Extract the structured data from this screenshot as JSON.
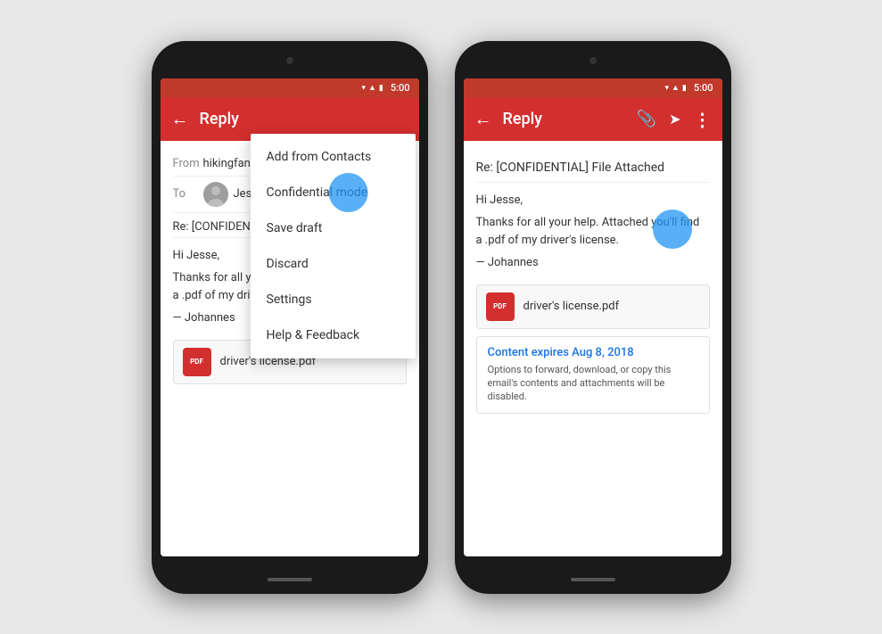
{
  "phone1": {
    "statusBar": {
      "time": "5:00"
    },
    "toolbar": {
      "title": "Reply",
      "backIcon": "←"
    },
    "emailFields": {
      "fromLabel": "From",
      "fromValue": "hikingfan@gma...",
      "toLabel": "To",
      "toValue": "Jesse Slit..."
    },
    "subject": "Re: [CONFIDENTIAL] Fil...",
    "bodyLines": [
      "Hi Jesse,",
      "",
      "Thanks for all your help. Attached you'll find",
      "a .pdf of my driver's license.",
      "",
      "— Johannes"
    ],
    "attachment": {
      "iconText": "PDF",
      "name": "driver's license.pdf"
    },
    "dropdown": {
      "items": [
        "Add from Contacts",
        "Confidential mode",
        "Save draft",
        "Discard",
        "Settings",
        "Help & Feedback"
      ]
    }
  },
  "phone2": {
    "statusBar": {
      "time": "5:00"
    },
    "toolbar": {
      "title": "Reply",
      "backIcon": "←",
      "attachIcon": "📎",
      "sendIcon": "➤",
      "moreIcon": "⋮"
    },
    "subject": "Re: [CONFIDENTIAL] File Attached",
    "bodyLines": [
      "Hi Jesse,",
      "",
      "Thanks for all your help. Attached you'll find",
      "a .pdf of my driver's license.",
      "",
      "— Johannes"
    ],
    "attachment": {
      "iconText": "PDF",
      "name": "driver's license.pdf"
    },
    "confidential": {
      "title": "Content expires Aug 8, 2018",
      "body": "Options to forward, download, or copy this email's contents and attachments will be disabled."
    }
  }
}
